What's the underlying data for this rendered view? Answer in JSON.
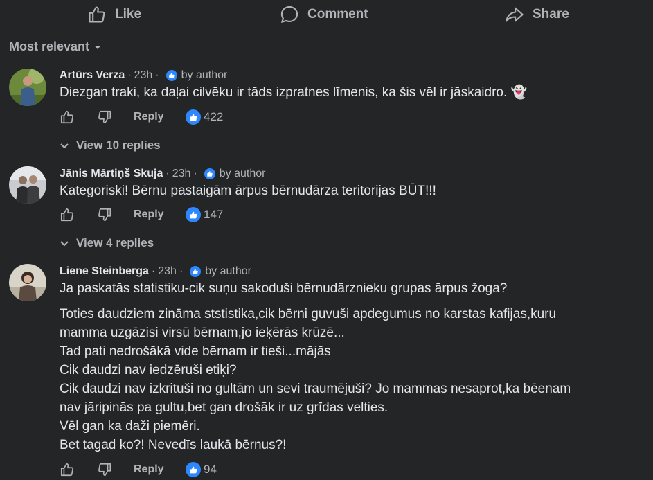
{
  "actions": {
    "like": "Like",
    "comment": "Comment",
    "share": "Share"
  },
  "sort": {
    "label": "Most relevant"
  },
  "comments": [
    {
      "name": "Artūrs Verza",
      "time": "23h",
      "by_author": "by author",
      "lines": [
        "Diezgan traki, ka daļai cilvēku ir tāds izpratnes līmenis, ka šis vēl ir jāskaidro. 👻"
      ],
      "reply_label": "Reply",
      "likes": "422",
      "view_replies": "View 10 replies"
    },
    {
      "name": "Jānis Mārtiņš Skuja",
      "time": "23h",
      "by_author": "by author",
      "lines": [
        "Kategoriski! Bērnu pastaigām ārpus bērnudārza teritorijas BŪT!!!"
      ],
      "reply_label": "Reply",
      "likes": "147",
      "view_replies": "View 4 replies"
    },
    {
      "name": "Liene Steinberga",
      "time": "23h",
      "by_author": "by author",
      "lines": [
        "Ja paskatās statistiku-cik suņu sakoduši bērnudārznieku grupas ārpus žoga?",
        "Toties daudziem zināma ststistika,cik bērni guvuši apdegumus no karstas kafijas,kuru",
        "mamma uzgāzisi virsū bērnam,jo ieķērās krūzē...",
        "Tad pati nedrošākā vide bērnam ir tieši...mājās",
        "Cik daudzi nav iedzēruši etiķi?",
        "Cik daudzi nav izkrituši no gultām un sevi traumējuši? Jo mammas nesaprot,ka bēenam",
        "nav jāripinās pa gultu,bet gan drošāk ir uz grīdas velties.",
        "Vēl gan ka daži piemēri.",
        "Bet tagad ko?! Nevedīs laukā bērnus?!"
      ],
      "reply_label": "Reply",
      "likes": "94"
    }
  ],
  "colors": {
    "background": "#242526",
    "text": "#e4e6eb",
    "secondary": "#b0b3b8",
    "accent": "#2d88ff"
  },
  "icons": [
    "thumbs-up-icon",
    "speech-bubble-icon",
    "share-arrow-icon",
    "caret-down-icon",
    "verified-badge-icon",
    "thumbs-down-icon",
    "chevron-down-icon",
    "like-reaction-icon"
  ]
}
